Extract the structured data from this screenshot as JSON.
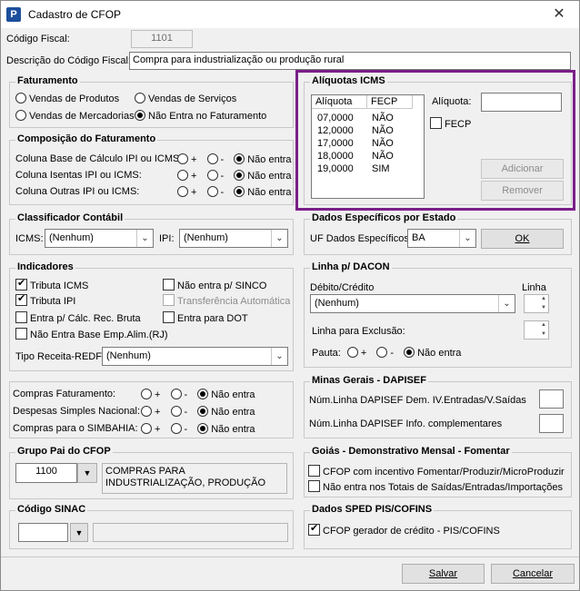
{
  "window": {
    "title": "Cadastro de CFOP",
    "app_icon_letter": "P",
    "close_glyph": "✕"
  },
  "codigo_fiscal": {
    "label": "Código Fiscal:",
    "value": "1101"
  },
  "descricao": {
    "label": "Descrição do Código Fiscal:",
    "value": "Compra para industrialização ou produção rural"
  },
  "faturamento": {
    "title": "Faturamento",
    "options": [
      "Vendas de Produtos",
      "Vendas de Serviços",
      "Vendas de Mercadorias",
      "Não Entra no Faturamento"
    ],
    "selected": "Não Entra no Faturamento"
  },
  "composicao": {
    "title": "Composição do Faturamento",
    "rows": [
      {
        "label": "Coluna Base de Cálculo IPI ou ICMS:"
      },
      {
        "label": "Coluna Isentas IPI ou ICMS:"
      },
      {
        "label": "Coluna Outras IPI ou ICMS:"
      }
    ],
    "opt_plus": "+",
    "opt_minus": "-",
    "opt_none": "Não entra"
  },
  "classificador": {
    "title": "Classificador Contábil",
    "icms_label": "ICMS:",
    "icms_value": "(Nenhum)",
    "ipi_label": "IPI:",
    "ipi_value": "(Nenhum)"
  },
  "indicadores": {
    "title": "Indicadores",
    "tributa_icms": "Tributa ICMS",
    "tributa_ipi": "Tributa IPI",
    "entra_calc": "Entra p/ Cálc. Rec. Bruta",
    "nao_entra_base": "Não Entra Base Emp.Alim.(RJ)",
    "nao_entra_sinco": "Não entra p/ SINCO",
    "transferencia": "Transferência Automática",
    "entra_dot": "Entra para DOT",
    "tipo_receita_label": "Tipo Receita-REDF:",
    "tipo_receita_value": "(Nenhum)"
  },
  "compras": {
    "rows": [
      {
        "label": "Compras Faturamento:"
      },
      {
        "label": "Despesas Simples Nacional:"
      },
      {
        "label": "Compras para o SIMBAHIA:"
      }
    ],
    "opt_plus": "+",
    "opt_minus": "-",
    "opt_none": "Não entra"
  },
  "grupo_pai": {
    "title": "Grupo Pai do CFOP",
    "code": "1100",
    "description": "COMPRAS PARA INDUSTRIALIZAÇÃO, PRODUÇÃO"
  },
  "sinac": {
    "title": "Código SINAC"
  },
  "aliquotas": {
    "title": "Alíquotas ICMS",
    "col_aliquota": "Alíquota",
    "col_fecp": "FECP",
    "rows": [
      {
        "aliquota": "07,0000",
        "fecp": "NÃO"
      },
      {
        "aliquota": "12,0000",
        "fecp": "NÃO"
      },
      {
        "aliquota": "17,0000",
        "fecp": "NÃO"
      },
      {
        "aliquota": "18,0000",
        "fecp": "NÃO"
      },
      {
        "aliquota": "19,0000",
        "fecp": "SIM"
      }
    ],
    "aliquota_label": "Alíquota:",
    "fecp_label": "FECP",
    "add_label": "Adicionar",
    "remove_label": "Remover",
    "highlight_color": "#7a1f88"
  },
  "dados_estado": {
    "title": "Dados Específicos por Estado",
    "uf_label": "UF Dados Específicos:",
    "uf_value": "BA",
    "ok_label": "OK"
  },
  "dacon": {
    "title": "Linha p/ DACON",
    "debito_label": "Débito/Crédito",
    "debito_value": "(Nenhum)",
    "linha_label": "Linha",
    "exclusao_label": "Linha para Exclusão:",
    "pauta_label": "Pauta:",
    "opt_plus": "+",
    "opt_minus": "-",
    "opt_none": "Não entra"
  },
  "minas": {
    "title": "Minas Gerais - DAPISEF",
    "entradas_label": "Núm.Linha DAPISEF Dem. IV.Entradas/V.Saídas",
    "info_label": "Núm.Linha DAPISEF Info. complementares"
  },
  "goias": {
    "title": "Goiás - Demonstrativo Mensal - Fomentar",
    "cfop_incentivo": "CFOP com incentivo  Fomentar/Produzir/MicroProduzir",
    "nao_entra_totais": "Não entra nos Totais de  Saídas/Entradas/Importações"
  },
  "sped": {
    "title": "Dados SPED PIS/COFINS",
    "gerador_credito": "CFOP gerador de crédito - PIS/COFINS"
  },
  "footer": {
    "save_label": "Salvar",
    "cancel_label": "Cancelar"
  }
}
